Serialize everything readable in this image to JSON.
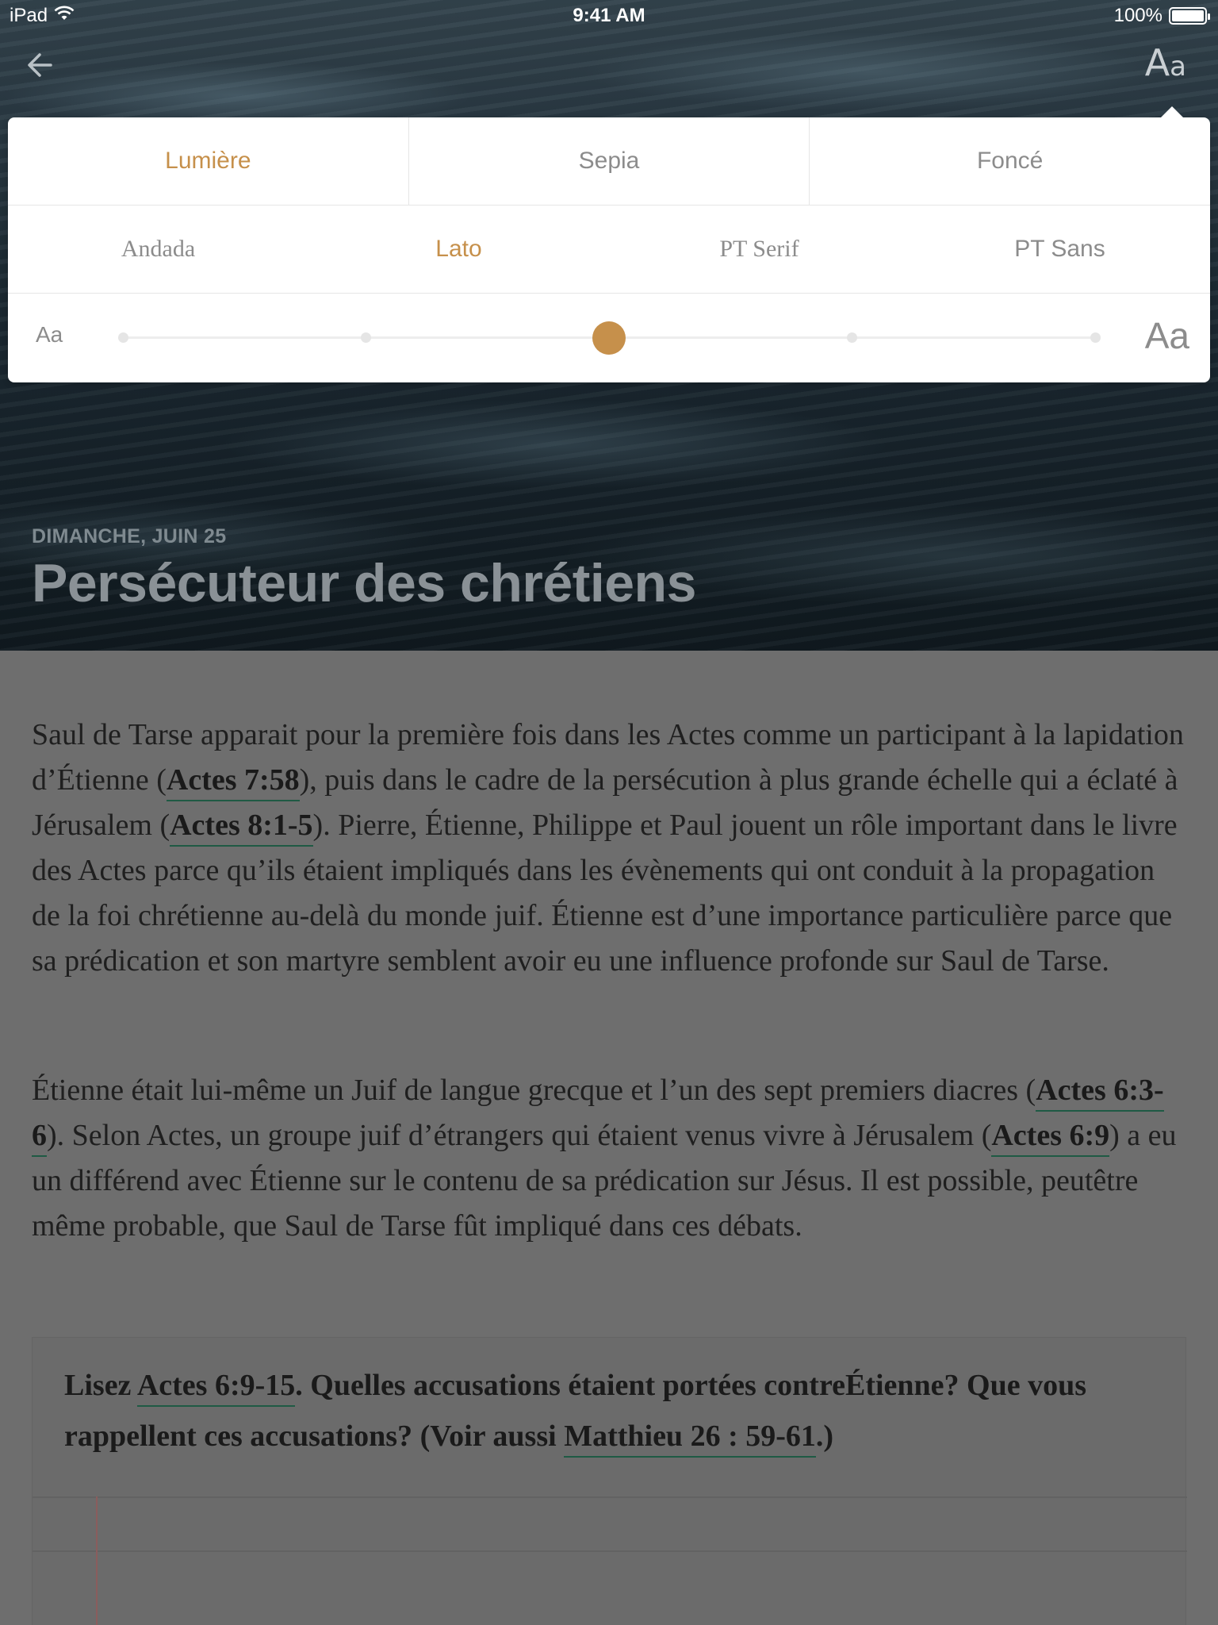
{
  "status_bar": {
    "device": "iPad",
    "time": "9:41 AM",
    "battery": "100%",
    "battery_level": 1.0
  },
  "nav": {
    "back_icon": "arrow-left-icon",
    "font_button": {
      "big": "A",
      "small": "a"
    }
  },
  "reader_settings": {
    "themes": [
      {
        "label": "Lumière",
        "active": true
      },
      {
        "label": "Sepia",
        "active": false
      },
      {
        "label": "Foncé",
        "active": false
      }
    ],
    "fonts": [
      {
        "label": "Andada",
        "active": false
      },
      {
        "label": "Lato",
        "active": true
      },
      {
        "label": "PT Serif",
        "active": false
      },
      {
        "label": "PT Sans",
        "active": false
      }
    ],
    "size": {
      "small_label": "Aa",
      "large_label": "Aa",
      "steps": 5,
      "selected_index": 2
    },
    "accent_color": "#c6904b"
  },
  "hero": {
    "date": "DIMANCHE, JUIN 25",
    "title": "Persécuteur des chrétiens"
  },
  "body": {
    "p1": [
      {
        "text": "Saul de Tarse apparait pour la première fois dans les Actes comme un participant à la lapidation d’Étienne ("
      },
      {
        "ref": "Actes 7:58"
      },
      {
        "text": "), puis dans le cadre de la persécution à plus grande échelle qui a éclaté à Jérusalem ("
      },
      {
        "ref": "Actes 8:1-5"
      },
      {
        "text": "). Pierre, Étienne, Philippe et Paul jouent un rôle important dans le livre des Actes parce qu’ils étaient impliqués dans les évènements qui ont conduit à la propagation de la foi chrétienne au-delà du monde juif. Étienne est d’une importance particulière parce que sa prédication et son martyre semblent avoir eu une influence profonde sur Saul de Tarse."
      }
    ],
    "p2": [
      {
        "text": "Étienne était lui-même un Juif de langue grecque et l’un des sept premiers diacres ("
      },
      {
        "ref": "Actes 6:3-6"
      },
      {
        "text": "). Selon Actes, un groupe juif d’étrangers qui étaient venus vivre à Jérusalem ("
      },
      {
        "ref": "Actes 6:9"
      },
      {
        "text": ") a eu un différend avec Étienne sur le contenu de sa prédication sur Jésus. Il est possible, peutêtre même probable, que Saul de Tarse fût impliqué dans ces débats."
      }
    ],
    "question": [
      {
        "text": "Lisez "
      },
      {
        "ref": "Actes 6:9-15"
      },
      {
        "text": ". Quelles accusations étaient portées contreÉtienne? Que vous rappellent ces accusations? (Voir aussi "
      },
      {
        "ref": "Matthieu 26 : 59-61"
      },
      {
        "text": ".)"
      }
    ]
  }
}
